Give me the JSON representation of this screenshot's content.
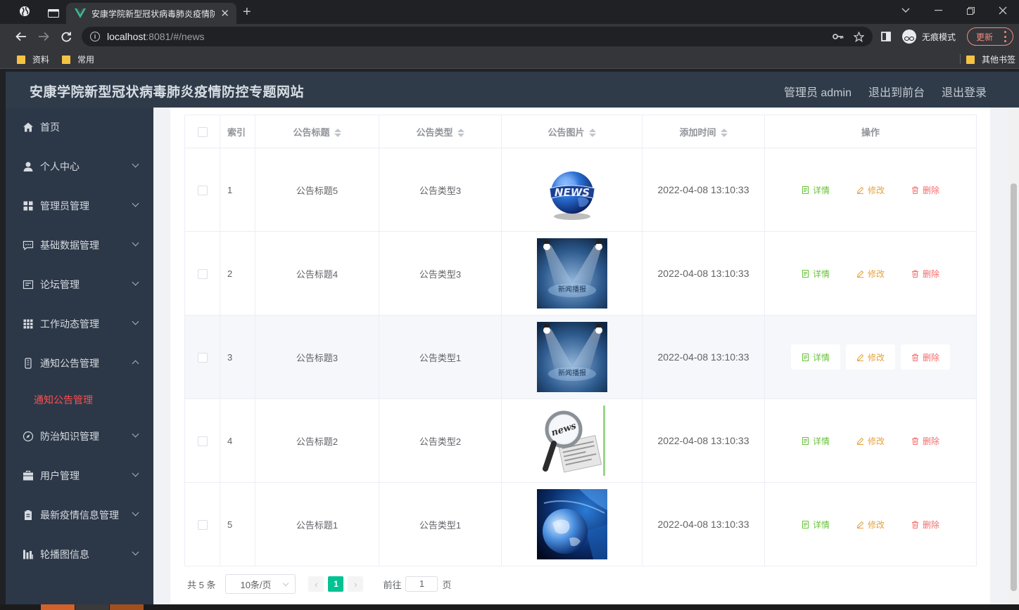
{
  "browser": {
    "active_tab_title": "安康学院新型冠状病毒肺炎疫情防控专题网站",
    "url_host": "localhost",
    "url_rest": ":8081/#/news",
    "incognito_label": "无痕模式",
    "update_label": "更新",
    "bookmarks": [
      "资料",
      "常用"
    ],
    "other_bookmarks": "其他书签"
  },
  "header": {
    "site_title": "安康学院新型冠状病毒肺炎疫情防控专题网站",
    "user_label": "管理员 admin",
    "to_front": "退出到前台",
    "logout": "退出登录"
  },
  "sidebar": {
    "home": "首页",
    "groups": [
      {
        "label": "个人中心",
        "icon": "user-icon"
      },
      {
        "label": "管理员管理",
        "icon": "grid-icon"
      },
      {
        "label": "基础数据管理",
        "icon": "chat-icon"
      },
      {
        "label": "论坛管理",
        "icon": "message-icon"
      },
      {
        "label": "工作动态管理",
        "icon": "apps-icon"
      },
      {
        "label": "通知公告管理",
        "icon": "phone-icon"
      },
      {
        "label": "防治知识管理",
        "icon": "compass-icon"
      },
      {
        "label": "用户管理",
        "icon": "briefcase-icon"
      },
      {
        "label": "最新疫情信息管理",
        "icon": "clipboard-icon"
      },
      {
        "label": "轮播图信息",
        "icon": "chart-icon"
      }
    ],
    "active_sub": "通知公告管理"
  },
  "table": {
    "headers": {
      "index": "索引",
      "title": "公告标题",
      "type": "公告类型",
      "image": "公告图片",
      "time": "添加时间",
      "actions": "操作"
    },
    "rows": [
      {
        "index": "1",
        "title": "公告标题5",
        "type": "公告类型3",
        "image": "news-globe",
        "time": "2022-04-08 13:10:33"
      },
      {
        "index": "2",
        "title": "公告标题4",
        "type": "公告类型3",
        "image": "news-broadcast",
        "image_text": "新闻播报",
        "time": "2022-04-08 13:10:33"
      },
      {
        "index": "3",
        "title": "公告标题3",
        "type": "公告类型1",
        "image": "news-broadcast",
        "image_text": "新闻播报",
        "time": "2022-04-08 13:10:33"
      },
      {
        "index": "4",
        "title": "公告标题2",
        "type": "公告类型2",
        "image": "magnifier-newspaper",
        "image_text": "news",
        "time": "2022-04-08 13:10:33"
      },
      {
        "index": "5",
        "title": "公告标题1",
        "type": "公告类型1",
        "image": "blue-globe",
        "time": "2022-04-08 13:10:33"
      }
    ],
    "actions": {
      "detail": "详情",
      "edit": "修改",
      "delete": "删除"
    }
  },
  "pagination": {
    "total": "共 5 条",
    "page_size": "10条/页",
    "prev": "‹",
    "current_page": "1",
    "next": "›",
    "goto_prefix": "前往",
    "goto_value": "1",
    "goto_suffix": "页"
  },
  "colors": {
    "header_bg": "#2f3b49",
    "sidebar_bg": "#2c3848",
    "active_menu": "#ff4d4f",
    "page_active": "#00c292",
    "detail": "#67c23a",
    "edit": "#e6a23c",
    "delete": "#f56c6c"
  }
}
